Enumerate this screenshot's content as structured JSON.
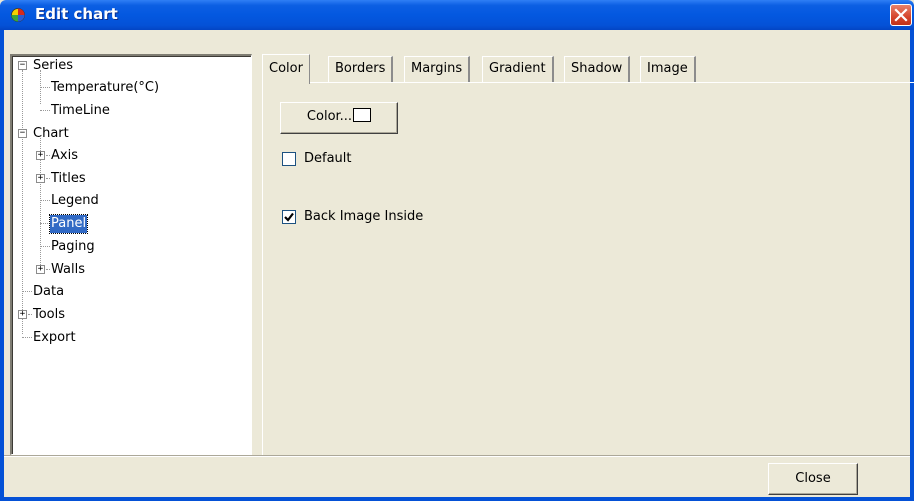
{
  "window": {
    "title": "Edit chart",
    "icon": "chart-app-icon",
    "close_icon": "close-icon"
  },
  "tree": {
    "items": [
      {
        "label": "Series",
        "expanded": true
      },
      {
        "label": "Temperature(°C)"
      },
      {
        "label": "TimeLine"
      },
      {
        "label": "Chart",
        "expanded": true
      },
      {
        "label": "Axis",
        "expanded": false
      },
      {
        "label": "Titles",
        "expanded": false
      },
      {
        "label": "Legend"
      },
      {
        "label": "Panel",
        "selected": true
      },
      {
        "label": "Paging"
      },
      {
        "label": "Walls",
        "expanded": false
      },
      {
        "label": "Data"
      },
      {
        "label": "Tools",
        "expanded": false
      },
      {
        "label": "Export"
      }
    ]
  },
  "tabs": [
    {
      "label": "Color",
      "active": true
    },
    {
      "label": "Borders"
    },
    {
      "label": "Margins"
    },
    {
      "label": "Gradient"
    },
    {
      "label": "Shadow"
    },
    {
      "label": "Image"
    }
  ],
  "color_tab": {
    "color_button_label": "Color...",
    "color_swatch": "#ffffff",
    "default_label": "Default",
    "default_checked": false,
    "back_image_label": "Back Image Inside",
    "back_image_checked": true
  },
  "footer": {
    "close_label": "Close"
  },
  "colors": {
    "title_bar": "#0451d6",
    "selection": "#316ac5",
    "dialog_bg": "#ece9d8",
    "close_red": "#d5452c"
  }
}
